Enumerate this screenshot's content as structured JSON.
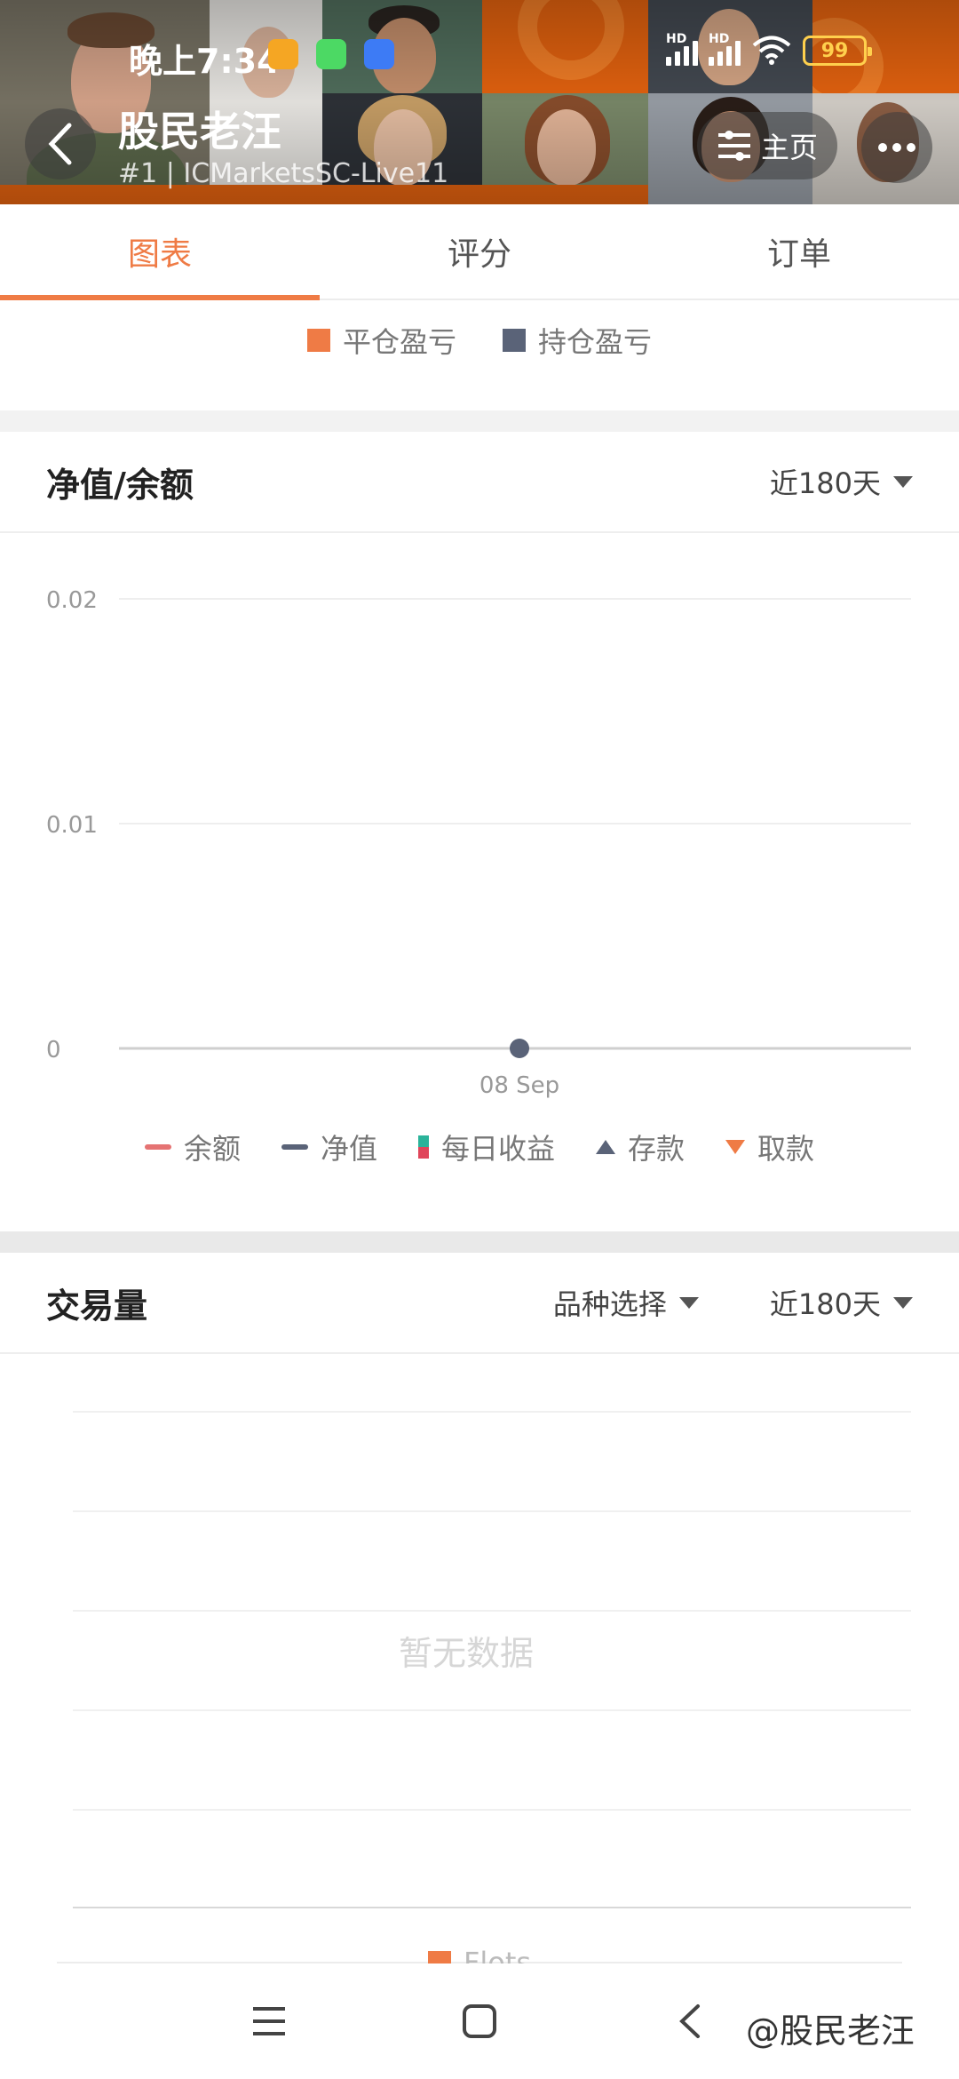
{
  "status_bar": {
    "time": "晚上7:34",
    "battery": "99",
    "network_label_1": "HD",
    "network_label_2": "HD"
  },
  "header": {
    "title": "股民老汪",
    "subtitle": "#1 | ICMarketsSC-Live11",
    "home_label": "主页"
  },
  "tabs": [
    {
      "label": "图表",
      "active": true
    },
    {
      "label": "评分",
      "active": false
    },
    {
      "label": "订单",
      "active": false
    }
  ],
  "pnl_legend": [
    {
      "label": "平仓盈亏",
      "color": "#ef7b45"
    },
    {
      "label": "持仓盈亏",
      "color": "#5a6378"
    }
  ],
  "equity_section": {
    "title": "净值/余额",
    "range_label": "近180天"
  },
  "chart_data": {
    "type": "line",
    "title": "净值/余额",
    "y_ticks": [
      "0.02",
      "0.01",
      "0"
    ],
    "ylim": [
      0,
      0.02
    ],
    "x": [
      "08 Sep"
    ],
    "series": [
      {
        "name": "净值",
        "values": [
          0
        ]
      }
    ],
    "grid": true,
    "legend_position": "bottom",
    "legend": [
      {
        "label": "余额",
        "kind": "line",
        "color": "#e57373"
      },
      {
        "label": "净值",
        "kind": "line",
        "color": "#5a6378"
      },
      {
        "label": "每日收益",
        "kind": "bar",
        "colors": [
          "#2bb39a",
          "#e0455a"
        ]
      },
      {
        "label": "存款",
        "kind": "triangle-up",
        "color": "#5a6378"
      },
      {
        "label": "取款",
        "kind": "triangle-down",
        "color": "#ef7b45"
      }
    ]
  },
  "volume_section": {
    "title": "交易量",
    "symbol_label": "品种选择",
    "range_label": "近180天",
    "empty_text": "暂无数据",
    "legend_label": "Flots",
    "legend_color": "#ef7b45"
  },
  "watermark": "@股民老汪"
}
